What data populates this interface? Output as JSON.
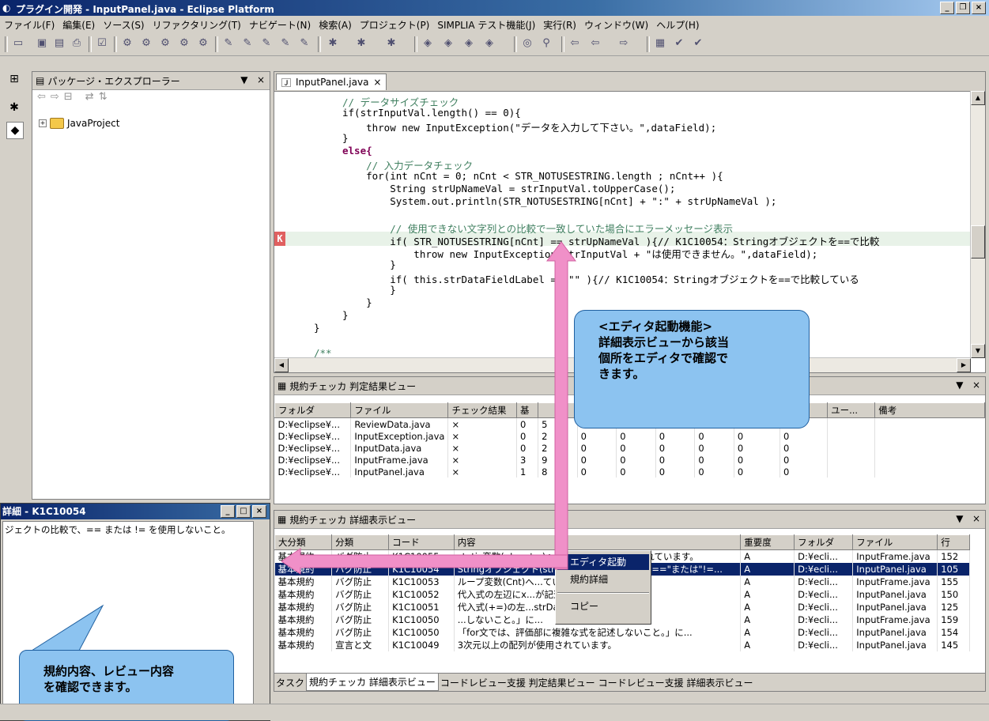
{
  "window": {
    "title": "プラグイン開発 - InputPanel.java - Eclipse Platform",
    "min_btn": "_",
    "max_btn": "❐",
    "close_btn": "×"
  },
  "menu": [
    "ファイル(F)",
    "編集(E)",
    "ソース(S)",
    "リファクタリング(T)",
    "ナビゲート(N)",
    "検索(A)",
    "プロジェクト(P)",
    "SIMPLIA テスト機能(J)",
    "実行(R)",
    "ウィンドウ(W)",
    "ヘルプ(H)"
  ],
  "package_explorer": {
    "title": "パッケージ・エクスプローラー",
    "tree_root": "JavaProject",
    "menu_glyph": "▼",
    "close_glyph": "×"
  },
  "editor": {
    "tab_label": "InputPanel.java",
    "tab_close": "×",
    "marker": "K",
    "lines": [
      "// データサイズチェック",
      "if(strInputVal.length() == 0){",
      "    throw new InputException(\"データを入力して下さい。\",dataField);",
      "}",
      "else{",
      "    // 入力データチェック",
      "    for(int nCnt = 0; nCnt < STR_NOTUSESTRING.length ; nCnt++ ){",
      "        String strUpNameVal = strInputVal.toUpperCase();",
      "        System.out.println(STR_NOTUSESTRING[nCnt] + \":\" + strUpNameVal );",
      "",
      "        // 使用できない文字列との比較で一致していた場合にエラーメッセージ表示",
      "        if( STR_NOTUSESTRING[nCnt] == strUpNameVal ){// K1C10054：Stringオブジェクトを==で比較",
      "            throw new InputException(strInputVal + \"は使用できません。\",dataField);",
      "        }",
      "        if( this.strDataFieldLabel == \"\" ){// K1C10054：Stringオブジェクトを==で比較している",
      "        }",
      "    }",
      "}",
      "}",
      "",
      "/**"
    ]
  },
  "result_view": {
    "title": "規約チェッカ 判定結果ビュー",
    "menu_glyph": "▼",
    "close_glyph": "×",
    "columns": [
      "フォルダ",
      "ファイル",
      "チェック結果",
      "基",
      "",
      "",
      "",
      "",
      "",
      "...",
      "ユー...",
      "ユー...",
      "備考"
    ],
    "rows": [
      [
        "D:¥eclipse¥...",
        "ReviewData.java",
        "×",
        "0",
        "5",
        "0",
        "0",
        "0",
        "0",
        "0",
        "0",
        ""
      ],
      [
        "D:¥eclipse¥...",
        "InputException.java",
        "×",
        "0",
        "2",
        "0",
        "0",
        "0",
        "0",
        "0",
        "0",
        ""
      ],
      [
        "D:¥eclipse¥...",
        "InputData.java",
        "×",
        "0",
        "2",
        "0",
        "0",
        "0",
        "0",
        "0",
        "0",
        ""
      ],
      [
        "D:¥eclipse¥...",
        "InputFrame.java",
        "×",
        "3",
        "9",
        "0",
        "0",
        "0",
        "0",
        "0",
        "0",
        ""
      ],
      [
        "D:¥eclipse¥...",
        "InputPanel.java",
        "×",
        "1",
        "8",
        "0",
        "0",
        "0",
        "0",
        "0",
        "0",
        ""
      ]
    ]
  },
  "detail_view": {
    "title": "規約チェッカ 詳細表示ビュー",
    "menu_glyph": "▼",
    "close_glyph": "×",
    "columns": [
      "大分類",
      "分類",
      "コード",
      "内容",
      "重要度",
      "フォルダ",
      "ファイル",
      "行"
    ],
    "rows": [
      [
        "基本規約",
        "バグ防止",
        "K1C10055",
        "static変数(nInput...)への書き込みがおこなわれています。",
        "A",
        "D:¥ecli...",
        "InputFrame.java",
        "152"
      ],
      [
        "基本規約",
        "バグ防止",
        "K1C10054",
        "Stringオブジェクト(strUpNameVal)の比較に\"==\"または\"!=...",
        "A",
        "D:¥ecli...",
        "InputPanel.java",
        "105"
      ],
      [
        "基本規約",
        "バグ防止",
        "K1C10053",
        "ループ変数(Cnt)へ...ています。",
        "A",
        "D:¥ecli...",
        "InputFrame.java",
        "155"
      ],
      [
        "基本規約",
        "バグ防止",
        "K1C10052",
        "代入式の左辺にx...が記述されていま...",
        "A",
        "D:¥ecli...",
        "InputPanel.java",
        "150"
      ],
      [
        "基本規約",
        "バグ防止",
        "K1C10051",
        "代入式(+=)の左...strData)が記述...",
        "A",
        "D:¥ecli...",
        "InputPanel.java",
        "125"
      ],
      [
        "基本規約",
        "バグ防止",
        "K1C10050",
        "...しないこと。」に...",
        "A",
        "D:¥ecli...",
        "InputFrame.java",
        "159"
      ],
      [
        "基本規約",
        "バグ防止",
        "K1C10050",
        "「for文では、評価部に複雑な式を記述しないこと。」に...",
        "A",
        "D:¥ecli...",
        "InputPanel.java",
        "154"
      ],
      [
        "基本規約",
        "宣言と文",
        "K1C10049",
        "3次元以上の配列が使用されています。",
        "A",
        "D:¥ecli...",
        "InputPanel.java",
        "145"
      ]
    ],
    "bottom_tabs": [
      "タスク",
      "規約チェッカ 詳細表示ビュー",
      "コードレビュー支援 判定結果ビュー",
      "コードレビュー支援 詳細表示ビュー"
    ]
  },
  "popup": {
    "title": "詳細 - K1C10054",
    "body": "ジェクトの比較で、== または != を使用しないこと。"
  },
  "context_menu": {
    "items": [
      "エディタ起動",
      "規約詳細",
      "コピー"
    ]
  },
  "callouts": {
    "editor_launch": [
      "<エディタ起動機能>",
      "詳細表示ビューから該当",
      "個所をエディタで確認で",
      "きます。"
    ],
    "rule_content": [
      "規約内容、レビュー内容",
      "を確認できます。"
    ]
  },
  "colors": {
    "arrow": "#f090c8",
    "callout_fill": "#8cc3f0",
    "selection": "#0a246a"
  }
}
